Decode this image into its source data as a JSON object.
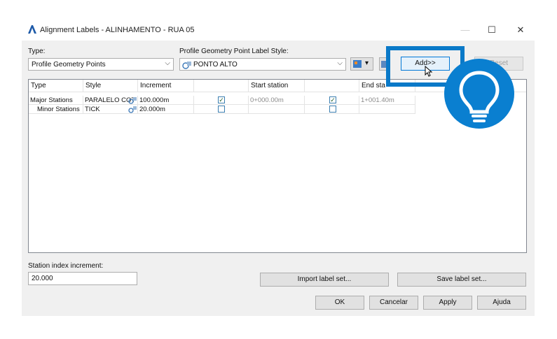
{
  "window": {
    "title": "Alignment Labels - ALINHAMENTO - RUA 05",
    "minimize": "—",
    "maximize": "☐",
    "close": "✕"
  },
  "type_field": {
    "label": "Type:",
    "value": "Profile Geometry Points"
  },
  "style_field": {
    "label": "Profile Geometry Point Label Style:",
    "value": "PONTO ALTO"
  },
  "buttons": {
    "add": "Add>>",
    "reset": "Reset",
    "import": "Import label set...",
    "save": "Save label set...",
    "ok": "OK",
    "cancel": "Cancelar",
    "apply": "Apply",
    "help": "Ajuda"
  },
  "table": {
    "headers": [
      "Type",
      "Style",
      "Increment",
      "",
      "Start station",
      "",
      "End sta"
    ],
    "rows": [
      {
        "type": "Major Stations",
        "style": "PARALELO COT",
        "increment": "100.000m",
        "start_checked": true,
        "start_station": "0+000.00m",
        "end_checked": true,
        "end_station": "1+001.40m"
      },
      {
        "type": "Minor Stations",
        "style": "TICK",
        "increment": "20.000m",
        "start_checked": false,
        "start_station": "",
        "end_checked": false,
        "end_station": ""
      }
    ]
  },
  "station_index": {
    "label": "Station index increment:",
    "value": "20.000"
  },
  "colors": {
    "accent": "#0a79c8",
    "bulb": "#0a7fd0"
  }
}
